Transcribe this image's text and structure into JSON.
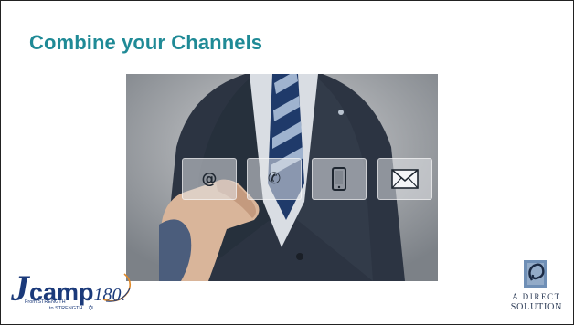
{
  "slide": {
    "title": "Combine your Channels"
  },
  "channels": [
    {
      "icon": "at-sign-icon",
      "glyph": "@"
    },
    {
      "icon": "phone-icon",
      "glyph": "✆"
    },
    {
      "icon": "tablet-icon",
      "glyph": ""
    },
    {
      "icon": "envelope-icon",
      "glyph": ""
    }
  ],
  "logos": {
    "jcamp": {
      "j": "J",
      "camp": "camp",
      "number": "180.",
      "tagline_1": "From STRENGTH",
      "tagline_2": "to STRENGTH"
    },
    "direct_solution": {
      "line_1": "A DIRECT",
      "line_2": "SOLUTION"
    }
  },
  "colors": {
    "title": "#1f8a96",
    "logo_navy": "#1b3a7a",
    "logo_orange": "#e08a2a",
    "ads_blue": "#6f8fb6"
  }
}
